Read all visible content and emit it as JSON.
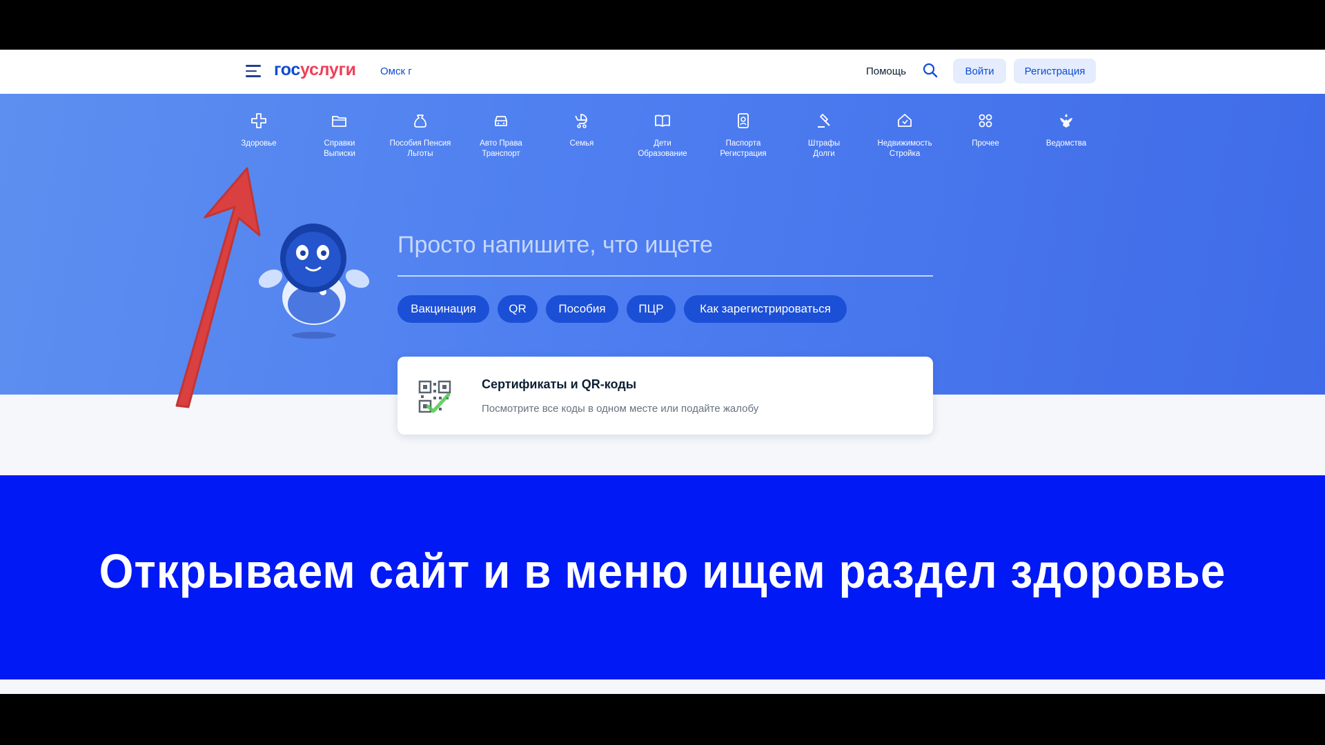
{
  "header": {
    "logo_part1": "гос",
    "logo_part2": "услуги",
    "city": "Омск г",
    "help": "Помощь",
    "login": "Войти",
    "register": "Регистрация"
  },
  "categories": [
    {
      "label": "Здоровье",
      "icon": "health-cross-icon"
    },
    {
      "label": "Справки Выписки",
      "icon": "folder-icon"
    },
    {
      "label": "Пособия Пенсия Льготы",
      "icon": "money-bag-icon"
    },
    {
      "label": "Авто Права Транспорт",
      "icon": "car-icon"
    },
    {
      "label": "Семья",
      "icon": "stroller-icon"
    },
    {
      "label": "Дети Образование",
      "icon": "book-icon"
    },
    {
      "label": "Паспорта Регистрация",
      "icon": "passport-icon"
    },
    {
      "label": "Штрафы Долги",
      "icon": "gavel-icon"
    },
    {
      "label": "Недвижимость Стройка",
      "icon": "house-icon"
    },
    {
      "label": "Прочее",
      "icon": "grid-icon"
    },
    {
      "label": "Ведомства",
      "icon": "coat-of-arms-icon"
    }
  ],
  "search": {
    "placeholder": "Просто напишите, что ищете"
  },
  "chips": [
    "Вакцинация",
    "QR",
    "Пособия",
    "ПЦР",
    "Как зарегистрироваться"
  ],
  "card": {
    "title": "Сертификаты и QR-коды",
    "subtitle": "Посмотрите все коды в одном месте или подайте жалобу"
  },
  "caption": "Открываем сайт и в меню ищем раздел здоровье",
  "colors": {
    "brand_blue": "#0d4cd3",
    "brand_red": "#ee3f58",
    "hero_blue": "#4e7ef0",
    "banner_blue": "#0019f5",
    "arrow_red": "#d9403f"
  }
}
